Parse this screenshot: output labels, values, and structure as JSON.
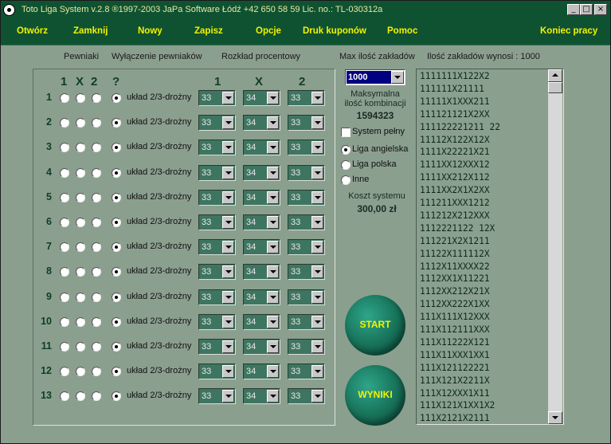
{
  "window": {
    "title": "Toto Liga System v.2.8  ®1997-2003 JaPa Software Łódź  +42 650 58 59     Lic. no.: TL-030312a",
    "min_label": "_",
    "max_label": "□",
    "close_label": "×"
  },
  "menu": {
    "items": [
      "Otwórz",
      "Zamknij",
      "Nowy",
      "Zapisz",
      "Opcje",
      "Druk kuponów",
      "Pomoc"
    ],
    "exit_label": "Koniec pracy"
  },
  "headers": {
    "pewniaki": "Pewniaki",
    "wylaczenie": "Wyłączenie pewniaków",
    "rozklad": "Rozkład procentowy",
    "max_ilosc": "Max ilość zakładów",
    "ilosc_wynosi": "Ilość zakładów wynosi : 1000"
  },
  "columns": {
    "pewniaki": [
      "1",
      "X",
      "2",
      "?"
    ],
    "rozklad": [
      "1",
      "X",
      "2"
    ]
  },
  "rows": [
    {
      "num": "1",
      "label": "układ 2/3-drożny",
      "p1": "33",
      "px": "34",
      "p2": "33"
    },
    {
      "num": "2",
      "label": "układ 2/3-drożny",
      "p1": "33",
      "px": "34",
      "p2": "33"
    },
    {
      "num": "3",
      "label": "układ 2/3-drożny",
      "p1": "33",
      "px": "34",
      "p2": "33"
    },
    {
      "num": "4",
      "label": "układ 2/3-drożny",
      "p1": "33",
      "px": "34",
      "p2": "33"
    },
    {
      "num": "5",
      "label": "układ 2/3-drożny",
      "p1": "33",
      "px": "34",
      "p2": "33"
    },
    {
      "num": "6",
      "label": "układ 2/3-drożny",
      "p1": "33",
      "px": "34",
      "p2": "33"
    },
    {
      "num": "7",
      "label": "układ 2/3-drożny",
      "p1": "33",
      "px": "34",
      "p2": "33"
    },
    {
      "num": "8",
      "label": "układ 2/3-drożny",
      "p1": "33",
      "px": "34",
      "p2": "33"
    },
    {
      "num": "9",
      "label": "układ 2/3-drożny",
      "p1": "33",
      "px": "34",
      "p2": "33"
    },
    {
      "num": "10",
      "label": "układ 2/3-drożny",
      "p1": "33",
      "px": "34",
      "p2": "33"
    },
    {
      "num": "11",
      "label": "układ 2/3-drożny",
      "p1": "33",
      "px": "34",
      "p2": "33"
    },
    {
      "num": "12",
      "label": "układ 2/3-drożny",
      "p1": "33",
      "px": "34",
      "p2": "33"
    },
    {
      "num": "13",
      "label": "układ 2/3-drożny",
      "p1": "33",
      "px": "34",
      "p2": "33"
    }
  ],
  "controls": {
    "max_select_value": "1000",
    "max_komb_label1": "Maksymalna",
    "max_komb_label2": "ilość kombinacji",
    "max_komb_value": "1594323",
    "system_pelny": "System pełny",
    "liga_options": [
      "Liga angielska",
      "Liga polska",
      "Inne"
    ],
    "liga_selected": 0,
    "koszt_label": "Koszt systemu",
    "koszt_value": "300,00 zł",
    "start_label": "START",
    "wyniki_label": "WYNIKI"
  },
  "list_items": [
    "1111111X122X2",
    "111111X21111",
    "11111X1XXX211",
    "111121121X2XX",
    "111122221211 22",
    "11112X122X12X",
    "1111X22221X21",
    "1111XX12XXX12",
    "1111XX212X112",
    "1111XX2X1X2XX",
    "111211XXX1212",
    "111212X212XXX",
    "1112221122 12X",
    "111221X2X1211",
    "11122X111112X",
    "1112X11XXXX22",
    "1112XX1X11221",
    "1112XX212X21X",
    "1112XX222X1XX",
    "111X111X12XXX",
    "111X112111XXX",
    "111X11222X121",
    "111X11XXX1XX1",
    "111X121122221",
    "111X121X2211X",
    "111X12XXX1X11",
    "111X121X1XX1X2",
    "111X2121X2111"
  ],
  "colors": {
    "menu_bg": "#0f5232",
    "menu_text": "#f3f300",
    "window_bg": "#8b9f8f",
    "accent": "#3e7560"
  }
}
